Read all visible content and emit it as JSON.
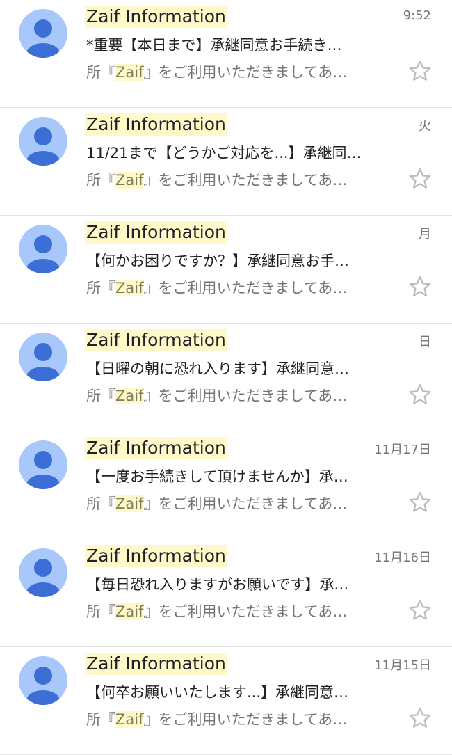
{
  "inbox": {
    "snippet_parts": {
      "before": "所『",
      "highlight": "Zaif",
      "after": "』をご利用いただきましてあ…"
    },
    "emails": [
      {
        "sender": "Zaif Information",
        "date": "9:52",
        "subject": "*重要【本日まで】承継同意お手続き…"
      },
      {
        "sender": "Zaif Information",
        "date": "火",
        "subject": "11/21まで【どうかご対応を...】承継同…"
      },
      {
        "sender": "Zaif Information",
        "date": "月",
        "subject": "【何かお困りですか？】承継同意お手…"
      },
      {
        "sender": "Zaif Information",
        "date": "日",
        "subject": "【日曜の朝に恐れ入ります】承継同意…"
      },
      {
        "sender": "Zaif Information",
        "date": "11月17日",
        "subject": "【一度お手続きして頂けませんか】承…"
      },
      {
        "sender": "Zaif Information",
        "date": "11月16日",
        "subject": "【毎日恐れ入りますがお願いです】承…"
      },
      {
        "sender": "Zaif Information",
        "date": "11月15日",
        "subject": "【何卒お願いいたします...】承継同意…"
      }
    ]
  },
  "colors": {
    "avatar_bg": "#a8c7fa",
    "avatar_fg": "#3b6fd6",
    "highlight": "#fff8c9",
    "star_outline": "#bdbdbd",
    "divider": "#e3e3e3"
  },
  "icons": {
    "avatar": "person-icon",
    "star": "star-outline-icon"
  }
}
